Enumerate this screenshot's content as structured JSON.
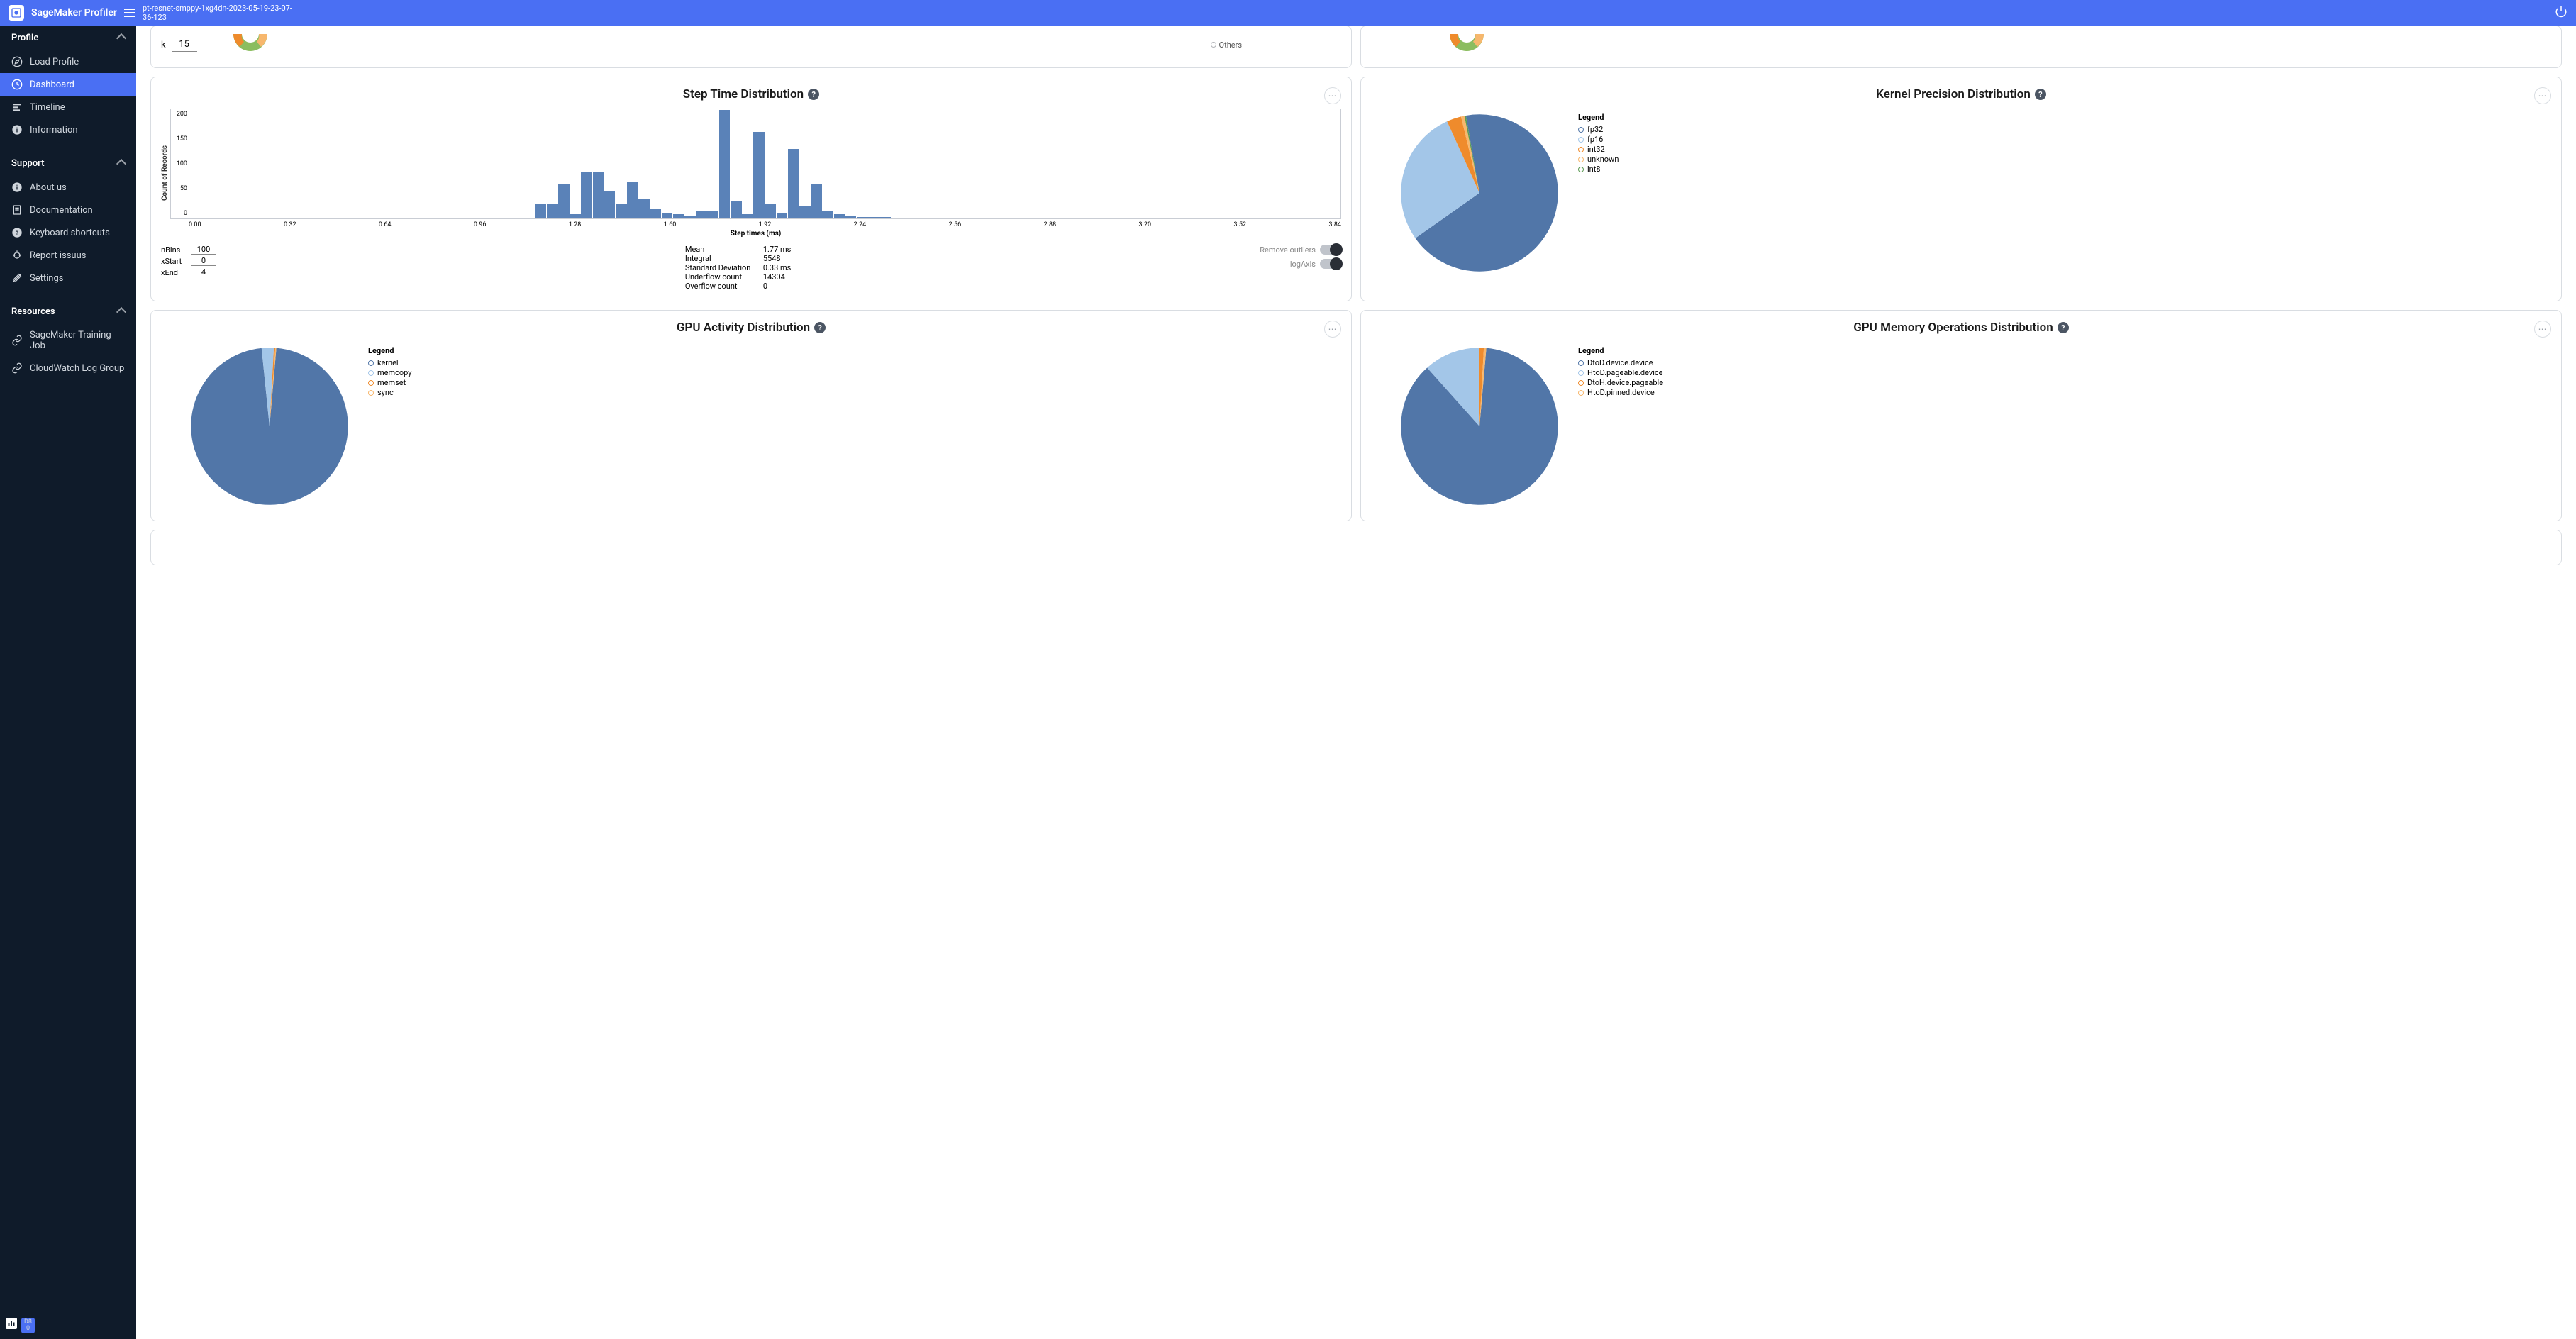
{
  "app_title": "SageMaker Profiler",
  "job_name": "pt-resnet-smppy-1xg4dn-2023-05-19-23-07-36-123",
  "sidebar": {
    "sections": [
      {
        "title": "Profile",
        "items": [
          "Load Profile",
          "Dashboard",
          "Timeline",
          "Information"
        ],
        "active_index": 1
      },
      {
        "title": "Support",
        "items": [
          "About us",
          "Documentation",
          "Keyboard shortcuts",
          "Report issuus",
          "Settings"
        ]
      },
      {
        "title": "Resources",
        "items": [
          "SageMaker Training Job",
          "CloudWatch Log Group"
        ]
      }
    ],
    "bottom_badge": {
      "label": "D8",
      "sub": "0"
    }
  },
  "partial_top": {
    "k_label": "k",
    "k_value": "15",
    "others_label": "Others"
  },
  "step_time": {
    "title": "Step Time Distribution",
    "ylabel": "Count of Records",
    "xlabel": "Step times (ms)",
    "controls": {
      "nbins_label": "nBins",
      "nbins_value": "100",
      "xstart_label": "xStart",
      "xstart_value": "0",
      "xend_label": "xEnd",
      "xend_value": "4"
    },
    "stats": {
      "mean_label": "Mean",
      "mean_value": "1.77 ms",
      "integral_label": "Integral",
      "integral_value": "5548",
      "std_label": "Standard Deviation",
      "std_value": "0.33 ms",
      "underflow_label": "Underflow count",
      "underflow_value": "14304",
      "overflow_label": "Overflow count",
      "overflow_value": "0"
    },
    "toggles": {
      "outliers": "Remove outliers",
      "log": "logAxis"
    }
  },
  "kernel_precision": {
    "title": "Kernel Precision Distribution",
    "legend_title": "Legend",
    "items": [
      {
        "label": "fp32",
        "color": "#5176a8"
      },
      {
        "label": "fp16",
        "color": "#a3c6e8"
      },
      {
        "label": "int32",
        "color": "#ef8b2c"
      },
      {
        "label": "unknown",
        "color": "#f7b76d"
      },
      {
        "label": "int8",
        "color": "#5c9a54"
      }
    ]
  },
  "gpu_activity": {
    "title": "GPU Activity Distribution",
    "legend_title": "Legend",
    "items": [
      {
        "label": "kernel",
        "color": "#5176a8"
      },
      {
        "label": "memcopy",
        "color": "#a3c6e8"
      },
      {
        "label": "memset",
        "color": "#ef8b2c"
      },
      {
        "label": "sync",
        "color": "#f7b76d"
      }
    ]
  },
  "gpu_memops": {
    "title": "GPU Memory Operations Distribution",
    "legend_title": "Legend",
    "items": [
      {
        "label": "DtoD.device.device",
        "color": "#5176a8"
      },
      {
        "label": "HtoD.pageable.device",
        "color": "#a3c6e8"
      },
      {
        "label": "DtoH.device.pageable",
        "color": "#ef8b2c"
      },
      {
        "label": "HtoD.pinned.device",
        "color": "#f7b76d"
      }
    ]
  },
  "chart_data": [
    {
      "type": "bar",
      "name": "step_time_histogram",
      "title": "Step Time Distribution",
      "xlabel": "Step times (ms)",
      "ylabel": "Count of Records",
      "x_ticks": [
        "0.00",
        "0.32",
        "0.64",
        "0.96",
        "1.28",
        "1.60",
        "1.92",
        "2.24",
        "2.56",
        "2.88",
        "3.20",
        "3.52",
        "3.84"
      ],
      "y_ticks": [
        0,
        50,
        100,
        150,
        200
      ],
      "ylim": [
        0,
        220
      ],
      "xlim": [
        0,
        4
      ],
      "bins": [
        {
          "x": 1.24,
          "count": 28
        },
        {
          "x": 1.28,
          "count": 70
        },
        {
          "x": 1.32,
          "count": 8
        },
        {
          "x": 1.4,
          "count": 95
        },
        {
          "x": 1.44,
          "count": 55
        },
        {
          "x": 1.48,
          "count": 30
        },
        {
          "x": 1.52,
          "count": 75
        },
        {
          "x": 1.56,
          "count": 40
        },
        {
          "x": 1.6,
          "count": 20
        },
        {
          "x": 1.64,
          "count": 10
        },
        {
          "x": 1.68,
          "count": 8
        },
        {
          "x": 1.72,
          "count": 5
        },
        {
          "x": 1.8,
          "count": 15
        },
        {
          "x": 1.84,
          "count": 218
        },
        {
          "x": 1.88,
          "count": 35
        },
        {
          "x": 1.92,
          "count": 8
        },
        {
          "x": 1.96,
          "count": 175
        },
        {
          "x": 2.0,
          "count": 30
        },
        {
          "x": 2.04,
          "count": 10
        },
        {
          "x": 2.08,
          "count": 140
        },
        {
          "x": 2.12,
          "count": 25
        },
        {
          "x": 2.16,
          "count": 70
        },
        {
          "x": 2.2,
          "count": 15
        },
        {
          "x": 2.24,
          "count": 8
        },
        {
          "x": 2.28,
          "count": 5
        },
        {
          "x": 2.32,
          "count": 3
        },
        {
          "x": 2.4,
          "count": 3
        }
      ]
    },
    {
      "type": "pie",
      "name": "kernel_precision",
      "title": "Kernel Precision Distribution",
      "series": [
        {
          "name": "fp32",
          "value": 68,
          "color": "#5176a8"
        },
        {
          "name": "fp16",
          "value": 28,
          "color": "#a3c6e8"
        },
        {
          "name": "int32",
          "value": 3,
          "color": "#ef8b2c"
        },
        {
          "name": "unknown",
          "value": 0.7,
          "color": "#f7b76d"
        },
        {
          "name": "int8",
          "value": 0.3,
          "color": "#5c9a54"
        }
      ]
    },
    {
      "type": "pie",
      "name": "gpu_activity",
      "title": "GPU Activity Distribution",
      "series": [
        {
          "name": "kernel",
          "value": 97,
          "color": "#5176a8"
        },
        {
          "name": "memcopy",
          "value": 2.5,
          "color": "#a3c6e8"
        },
        {
          "name": "memset",
          "value": 0.3,
          "color": "#ef8b2c"
        },
        {
          "name": "sync",
          "value": 0.2,
          "color": "#f7b76d"
        }
      ]
    },
    {
      "type": "pie",
      "name": "gpu_memops",
      "title": "GPU Memory Operations Distribution",
      "series": [
        {
          "name": "DtoD.device.device",
          "value": 87,
          "color": "#5176a8"
        },
        {
          "name": "HtoD.pageable.device",
          "value": 11.5,
          "color": "#a3c6e8"
        },
        {
          "name": "DtoH.device.pageable",
          "value": 1,
          "color": "#ef8b2c"
        },
        {
          "name": "HtoD.pinned.device",
          "value": 0.5,
          "color": "#f7b76d"
        }
      ]
    }
  ]
}
